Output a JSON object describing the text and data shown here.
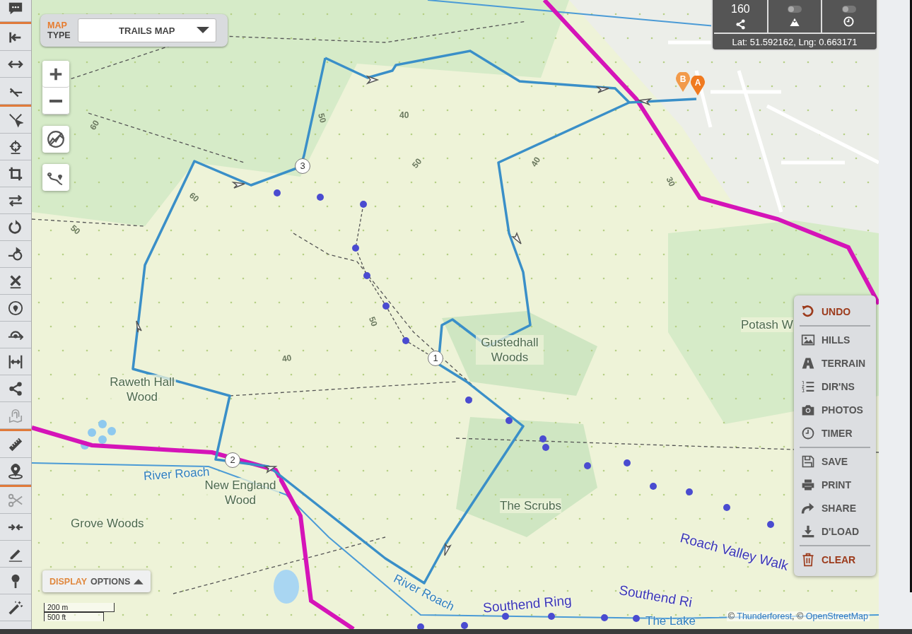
{
  "toolbar": [
    [
      {
        "disabled": false
      }
    ],
    [
      {
        "disabled": false
      },
      {
        "disabled": false
      },
      {
        "disabled": false
      }
    ],
    [
      {
        "disabled": false
      },
      {
        "disabled": false
      },
      {
        "disabled": false
      },
      {
        "disabled": false
      },
      {
        "disabled": false
      },
      {
        "disabled": false
      },
      {
        "disabled": false
      },
      {
        "disabled": false
      },
      {
        "disabled": false
      },
      {
        "disabled": false
      },
      {
        "disabled": false
      },
      {
        "disabled": true
      }
    ],
    [
      {
        "disabled": false
      },
      {
        "disabled": false
      }
    ],
    [
      {
        "disabled": true
      },
      {
        "disabled": false
      },
      {
        "disabled": false
      },
      {
        "disabled": false
      },
      {
        "disabled": false
      }
    ]
  ],
  "map_type": {
    "label_top": "MAP",
    "label_bottom": "TYPE",
    "value": "TRAILS MAP"
  },
  "stats": {
    "distance": "160",
    "toggles": [
      {
        "on": false
      },
      {
        "on": false
      }
    ],
    "coordinates": "Lat: 51.592162, Lng: 0.663171"
  },
  "map_labels": [
    {
      "text": "Raweth Hall Wood",
      "kind": "place"
    },
    {
      "text": "River Roach",
      "kind": "water"
    },
    {
      "text": "New England Wood",
      "kind": "place"
    },
    {
      "text": "Grove Woods",
      "kind": "place"
    },
    {
      "text": "Gustedhall Woods",
      "kind": "place"
    },
    {
      "text": "The Scrubs",
      "kind": "place"
    },
    {
      "text": "Potash W",
      "kind": "place"
    },
    {
      "text": "Roach Valley Walk",
      "kind": "trail"
    },
    {
      "text": "River Roach",
      "kind": "water"
    },
    {
      "text": "Southend Ring",
      "kind": "trail"
    },
    {
      "text": "Southend Ri",
      "kind": "trail"
    },
    {
      "text": "The Lake",
      "kind": "water"
    }
  ],
  "contours": [
    "60",
    "60",
    "50",
    "50",
    "40",
    "50",
    "40",
    "30",
    "50",
    "40"
  ],
  "markers": [
    "1",
    "2",
    "3"
  ],
  "pins": [
    {
      "label": "B"
    },
    {
      "label": "A"
    }
  ],
  "menu": [
    [
      {
        "label": "UNDO",
        "accent": true
      }
    ],
    [
      {
        "label": "HILLS",
        "accent": false
      },
      {
        "label": "TERRAIN",
        "accent": false
      },
      {
        "label": "DIR'NS",
        "accent": false
      },
      {
        "label": "PHOTOS",
        "accent": false
      },
      {
        "label": "TIMER",
        "accent": false
      }
    ],
    [
      {
        "label": "SAVE",
        "accent": false
      },
      {
        "label": "PRINT",
        "accent": false
      },
      {
        "label": "SHARE",
        "accent": false
      },
      {
        "label": "D'LOAD",
        "accent": false
      }
    ],
    [
      {
        "label": "CLEAR",
        "accent": true
      }
    ]
  ],
  "display_options": {
    "highlight": "DISPLAY",
    "rest": "OPTIONS"
  },
  "scale": [
    "200 m",
    "500 ft"
  ],
  "attribution": [
    {
      "text": "© ",
      "link": false
    },
    {
      "text": "Thunderforest",
      "link": true
    },
    {
      "text": ", © ",
      "link": false
    },
    {
      "text": "OpenStreetMap",
      "link": true
    }
  ]
}
